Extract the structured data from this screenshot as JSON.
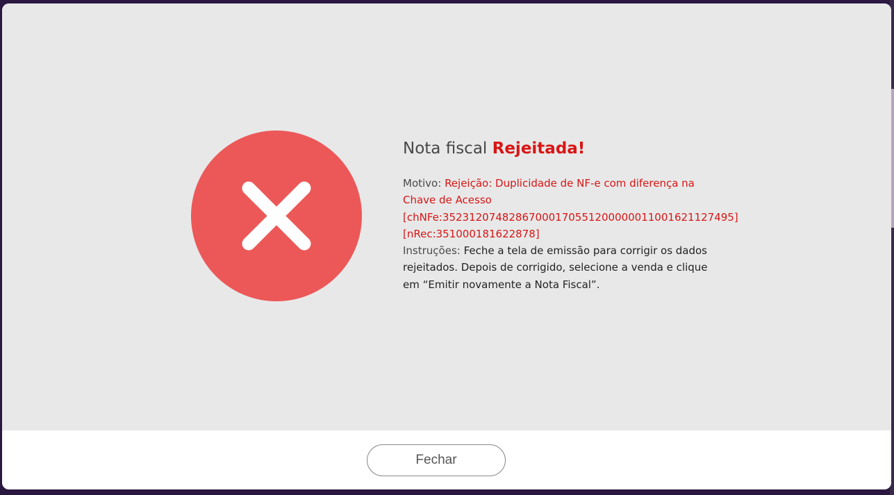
{
  "dialog": {
    "icon": "close-x-icon",
    "colors": {
      "error_red": "#ec5858",
      "status_text_red": "#d91515",
      "body_background": "#e8e8e8"
    },
    "title_prefix": "Nota fiscal",
    "title_status": "Rejeitada!",
    "reason_label": "Motivo:",
    "reason_text": "Rejeição: Duplicidade de NF-e com diferença na Chave de Acesso [chNFe:35231207482867000170551200000011001621127495][nRec:351000181622878]",
    "instructions_label": "Instruções:",
    "instructions_text": "Feche a tela de emissão para corrigir os dados rejeitados. Depois de corrigido, selecione a venda e clique em “Emitir novamente a Nota Fiscal”.",
    "close_button_label": "Fechar"
  }
}
